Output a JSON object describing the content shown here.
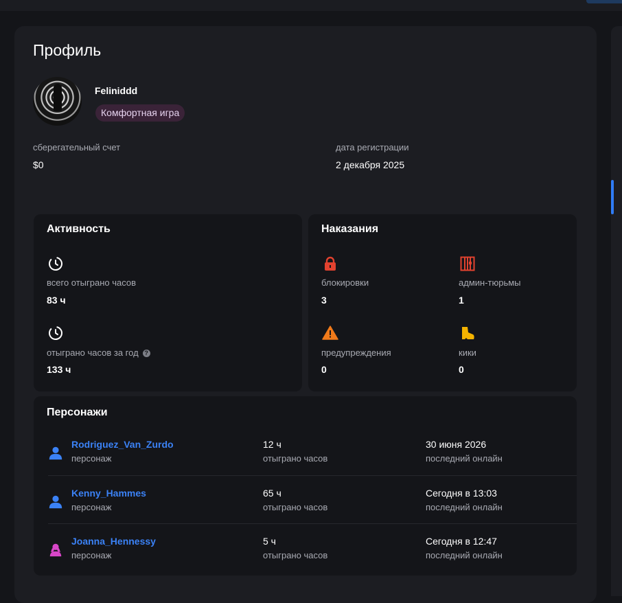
{
  "colors": {
    "accent": "#3b82f6",
    "danger": "#e2422f",
    "warning": "#f07a1a",
    "kick": "#f5b300",
    "badge_bg": "#3a2338"
  },
  "profile": {
    "title": "Профиль",
    "username": "Feliniddd",
    "badge": "Комфортная игра",
    "savings": {
      "label": "сберегательный счет",
      "value": "$0"
    },
    "registration": {
      "label": "дата регистрации",
      "value": "2 декабря 2025"
    }
  },
  "activity": {
    "title": "Активность",
    "items": [
      {
        "icon": "clock-icon",
        "label": "всего отыграно часов",
        "value": "83 ч"
      },
      {
        "icon": "clock-icon",
        "label": "отыграно часов за год",
        "value": "133 ч",
        "help": "?"
      }
    ]
  },
  "punishments": {
    "title": "Наказания",
    "items": [
      {
        "icon": "lock-icon",
        "label": "блокировки",
        "value": "3"
      },
      {
        "icon": "jail-icon",
        "label": "админ-тюрьмы",
        "value": "1"
      },
      {
        "icon": "warning-icon",
        "label": "предупреждения",
        "value": "0"
      },
      {
        "icon": "boot-icon",
        "label": "кики",
        "value": "0"
      }
    ]
  },
  "characters": {
    "title": "Персонажи",
    "rows": [
      {
        "icon": "male-person-icon",
        "name": "Rodriguez_Van_Zurdo",
        "type": "персонаж",
        "hours": "12 ч",
        "hours_label": "отыграно часов",
        "last_online": "30 июня 2026",
        "last_online_label": "последний онлайн"
      },
      {
        "icon": "male-person-icon",
        "name": "Kenny_Hammes",
        "type": "персонаж",
        "hours": "65 ч",
        "hours_label": "отыграно часов",
        "last_online": "Сегодня в 13:03",
        "last_online_label": "последний онлайн"
      },
      {
        "icon": "female-person-icon",
        "name": "Joanna_Hennessy",
        "type": "персонаж",
        "hours": "5 ч",
        "hours_label": "отыграно часов",
        "last_online": "Сегодня в 12:47",
        "last_online_label": "последний онлайн"
      }
    ]
  }
}
